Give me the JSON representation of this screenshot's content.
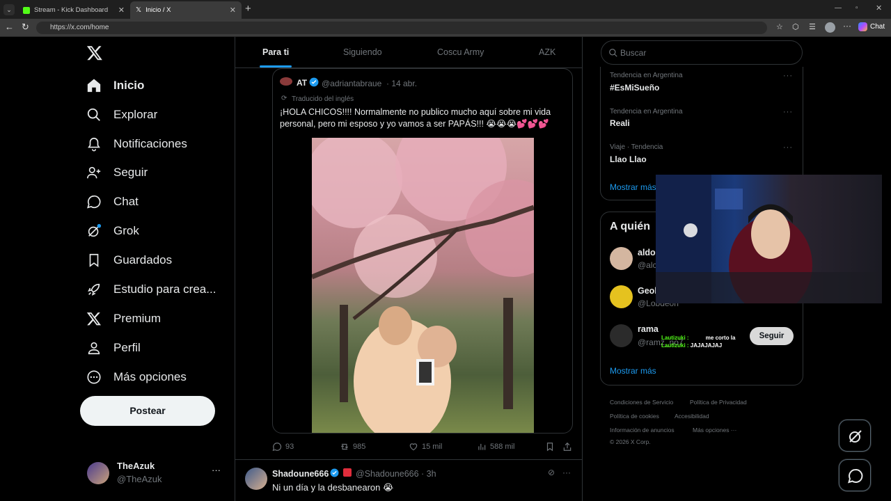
{
  "browser": {
    "tabs": [
      {
        "label": "Stream - Kick Dashboard",
        "active": false
      },
      {
        "label": "Inicio / X",
        "active": true
      }
    ],
    "url": "https://x.com/home",
    "chat_label": "Chat"
  },
  "sidebar": {
    "items": [
      {
        "label": "Inicio",
        "icon": "home-icon",
        "bold": true
      },
      {
        "label": "Explorar",
        "icon": "search-icon"
      },
      {
        "label": "Notificaciones",
        "icon": "bell-icon"
      },
      {
        "label": "Seguir",
        "icon": "follow-icon"
      },
      {
        "label": "Chat",
        "icon": "chat-icon"
      },
      {
        "label": "Grok",
        "icon": "grok-icon"
      },
      {
        "label": "Guardados",
        "icon": "bookmark-icon"
      },
      {
        "label": "Estudio para crea...",
        "icon": "rocket-icon"
      },
      {
        "label": "Premium",
        "icon": "x-logo-icon"
      },
      {
        "label": "Perfil",
        "icon": "person-icon"
      },
      {
        "label": "Más opciones",
        "icon": "more-icon"
      }
    ],
    "post_label": "Postear",
    "account": {
      "name": "TheAzuk",
      "handle": "@TheAzuk",
      "more": "···"
    }
  },
  "feed": {
    "tabs": [
      "Para ti",
      "Siguiendo",
      "Coscu Army",
      "AZK"
    ],
    "quoted": {
      "name": "AT",
      "handle": "@adriantabraue",
      "date": "· 14 abr.",
      "translated": "Traducido del inglés",
      "text": "¡HOLA CHICOS!!!! Normalmente no publico mucho aquí sobre mi vida personal, pero mi esposo y yo vamos a ser PAPÁS!!! 😭😭😭💕💕💕"
    },
    "actions": {
      "replies": "93",
      "reposts": "985",
      "likes": "15 mil",
      "views": "588 mil"
    },
    "next_post": {
      "name": "Shadoune666",
      "handle": "@Shadoune666 · 3h",
      "text": "Ni un día y la desbanearon 😭"
    }
  },
  "right": {
    "search_placeholder": "Buscar",
    "trends": [
      {
        "category": "Tendencia en Argentina",
        "name": "#EsMiSueño"
      },
      {
        "category": "Tendencia en Argentina",
        "name": "Reali"
      },
      {
        "category": "Viaje · Tendencia",
        "name": "Llao Llao"
      }
    ],
    "show_more": "Mostrar más",
    "who_to_follow_title": "A quién",
    "follow_suggestions": [
      {
        "name": "aldo",
        "handle": "@alc"
      },
      {
        "name": "Geol",
        "handle": "@Lobdeon"
      },
      {
        "name": "rama",
        "handle": "@ramz_no7"
      }
    ],
    "follow_label": "Seguir",
    "show_more_2": "Mostrar más",
    "footer": {
      "l1": "Condiciones de Servicio",
      "l2": "Política de Privacidad",
      "l3": "Política de cookies",
      "l4": "Accesibilidad",
      "l5": "Información de anuncios",
      "l6": "Más opciones ···",
      "copyright": "© 2026 X Corp."
    }
  },
  "stream_overlay": {
    "chat": [
      {
        "user": "Lautizuki :",
        "msg": "me corto la"
      },
      {
        "user": "Lautizuki :",
        "msg": "JAJAJAJAJ"
      }
    ]
  },
  "colors": {
    "accent": "#1d9bf0",
    "background": "#000000",
    "border": "#2f3336",
    "muted": "#71767b"
  }
}
